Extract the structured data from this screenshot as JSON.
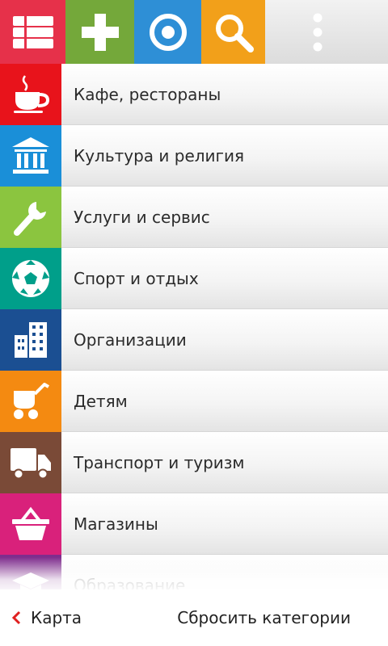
{
  "colors": {
    "cafe": "#e8131b",
    "culture": "#1a8fd8",
    "services": "#8bc53f",
    "sport": "#009f8a",
    "organizations": "#1b4f92",
    "kids": "#f48a11",
    "transport": "#7a4a37",
    "shops": "#d9217b",
    "education": "#7e2d8d",
    "toolbar_categories": "#e6314a",
    "toolbar_add": "#74a83a",
    "toolbar_locate": "#2e8fd6",
    "toolbar_search": "#f2a01a",
    "back_arrow": "#e02020"
  },
  "toolbar": {
    "buttons": [
      {
        "icon": "list-icon"
      },
      {
        "icon": "plus-icon"
      },
      {
        "icon": "target-icon"
      },
      {
        "icon": "search-icon"
      },
      {
        "icon": "more-vertical-icon"
      }
    ]
  },
  "categories": [
    {
      "label": "Кафе, рестораны",
      "icon": "coffee-cup-icon"
    },
    {
      "label": "Культура и религия",
      "icon": "museum-icon"
    },
    {
      "label": "Услуги и сервис",
      "icon": "wrench-icon"
    },
    {
      "label": "Спорт и отдых",
      "icon": "soccer-ball-icon"
    },
    {
      "label": "Организации",
      "icon": "office-building-icon"
    },
    {
      "label": "Детям",
      "icon": "baby-stroller-icon"
    },
    {
      "label": "Транспорт и туризм",
      "icon": "truck-icon"
    },
    {
      "label": "Магазины",
      "icon": "shopping-basket-icon"
    },
    {
      "label": "Образование",
      "icon": "graduation-cap-icon"
    }
  ],
  "bottom_bar": {
    "back_label": "Карта",
    "reset_label": "Сбросить категории"
  }
}
